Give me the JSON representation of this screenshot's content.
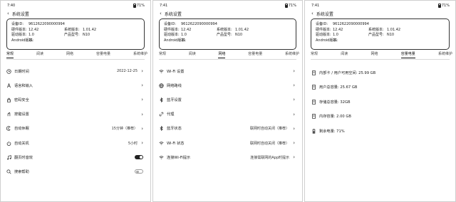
{
  "panels": [
    {
      "status_time": "7:40",
      "battery_text": "71%",
      "title": "系统设置",
      "info": [
        {
          "k": "设备ID:",
          "v": "9612622090000994"
        },
        {
          "k": "硬件版本:",
          "v": "12.42",
          "k2": "系统版本:",
          "v2": "1.01.42"
        },
        {
          "k": "驱动版本:",
          "v": "1.0",
          "k2": "产品型号:",
          "v2": "N10"
        },
        {
          "k": "Android版本:",
          "v": "11"
        }
      ],
      "tabs": [
        "常规",
        "阅读",
        "网络",
        "容量电量",
        "系统维护"
      ],
      "active_tab": 0,
      "items": [
        {
          "icon": "clock-icon",
          "label": "日期时间",
          "value": "2022-12-25",
          "ctrl": "chevron"
        },
        {
          "icon": "font-icon",
          "label": "语言和输入",
          "value": "",
          "ctrl": "chevron"
        },
        {
          "icon": "lock-icon",
          "label": "密码安全",
          "value": "",
          "ctrl": "chevron"
        },
        {
          "icon": "gesture-icon",
          "label": "按键设置",
          "value": "",
          "ctrl": "chevron"
        },
        {
          "icon": "moon-icon",
          "label": "自动休眠",
          "value": "15分钟（推荐）",
          "ctrl": "chevron"
        },
        {
          "icon": "power-icon",
          "label": "自动关机",
          "value": "5小时",
          "ctrl": "chevron"
        },
        {
          "icon": "music-icon",
          "label": "翻页时音效",
          "value": "",
          "ctrl": "toggle-on"
        },
        {
          "icon": "search-icon",
          "label": "搜索帮助",
          "value": "",
          "ctrl": "toggle-off"
        }
      ]
    },
    {
      "status_time": "7:41",
      "battery_text": "71%",
      "title": "系统设置",
      "info": [
        {
          "k": "设备ID:",
          "v": "9612622090000994"
        },
        {
          "k": "硬件版本:",
          "v": "12.42",
          "k2": "系统版本:",
          "v2": "1.01.42"
        },
        {
          "k": "驱动版本:",
          "v": "1.0",
          "k2": "产品型号:",
          "v2": "N10"
        },
        {
          "k": "Android版本:",
          "v": "11"
        }
      ],
      "tabs": [
        "常规",
        "阅读",
        "网络",
        "容量电量",
        "系统维护"
      ],
      "active_tab": 2,
      "items": [
        {
          "icon": "wifi-icon",
          "label": "Wi-Fi 设置",
          "value": "",
          "ctrl": "chevron"
        },
        {
          "icon": "globe-icon",
          "label": "网络路线",
          "value": "",
          "ctrl": "chevron"
        },
        {
          "icon": "bluetooth-icon",
          "label": "蓝牙设置",
          "value": "",
          "ctrl": "chevron"
        },
        {
          "icon": "link-icon",
          "label": "代理",
          "value": "",
          "ctrl": "chevron"
        },
        {
          "icon": "bluetooth-icon",
          "label": "蓝牙状态",
          "value": "联网时自动关闭（推荐）",
          "ctrl": "chevron"
        },
        {
          "icon": "wifi-icon",
          "label": "Wi-Fi 状态",
          "value": "联网时自动关闭（推荐）",
          "ctrl": "chevron"
        },
        {
          "icon": "wifi-icon",
          "label": "连接Wi-Fi提示",
          "value": "连接需联网的App时提示",
          "ctrl": "chevron"
        }
      ]
    },
    {
      "status_time": "7:41",
      "battery_text": "71%",
      "title": "系统设置",
      "info": [
        {
          "k": "设备ID:",
          "v": "9612622090000994"
        },
        {
          "k": "硬件版本:",
          "v": "12.42",
          "k2": "系统版本:",
          "v2": "1.01.42"
        },
        {
          "k": "驱动版本:",
          "v": "1.0",
          "k2": "产品型号:",
          "v2": "N10"
        },
        {
          "k": "Android版本:",
          "v": "11"
        }
      ],
      "tabs": [
        "常规",
        "阅读",
        "网络",
        "容量电量",
        "系统维护"
      ],
      "active_tab": 3,
      "items": [
        {
          "icon": "storage-icon",
          "label": "内部卡 / 用户可用空间: ",
          "value": "25.99 GB"
        },
        {
          "icon": "storage-icon",
          "label": "用户总容量: ",
          "value": "25.67 GB"
        },
        {
          "icon": "storage-icon",
          "label": "存储总容量: ",
          "value": "32GB"
        },
        {
          "icon": "storage-icon",
          "label": "内存容量: ",
          "value": "2.00 GB"
        },
        {
          "icon": "battery-icon",
          "label": "剩余电量: ",
          "value": "71%"
        }
      ]
    }
  ]
}
